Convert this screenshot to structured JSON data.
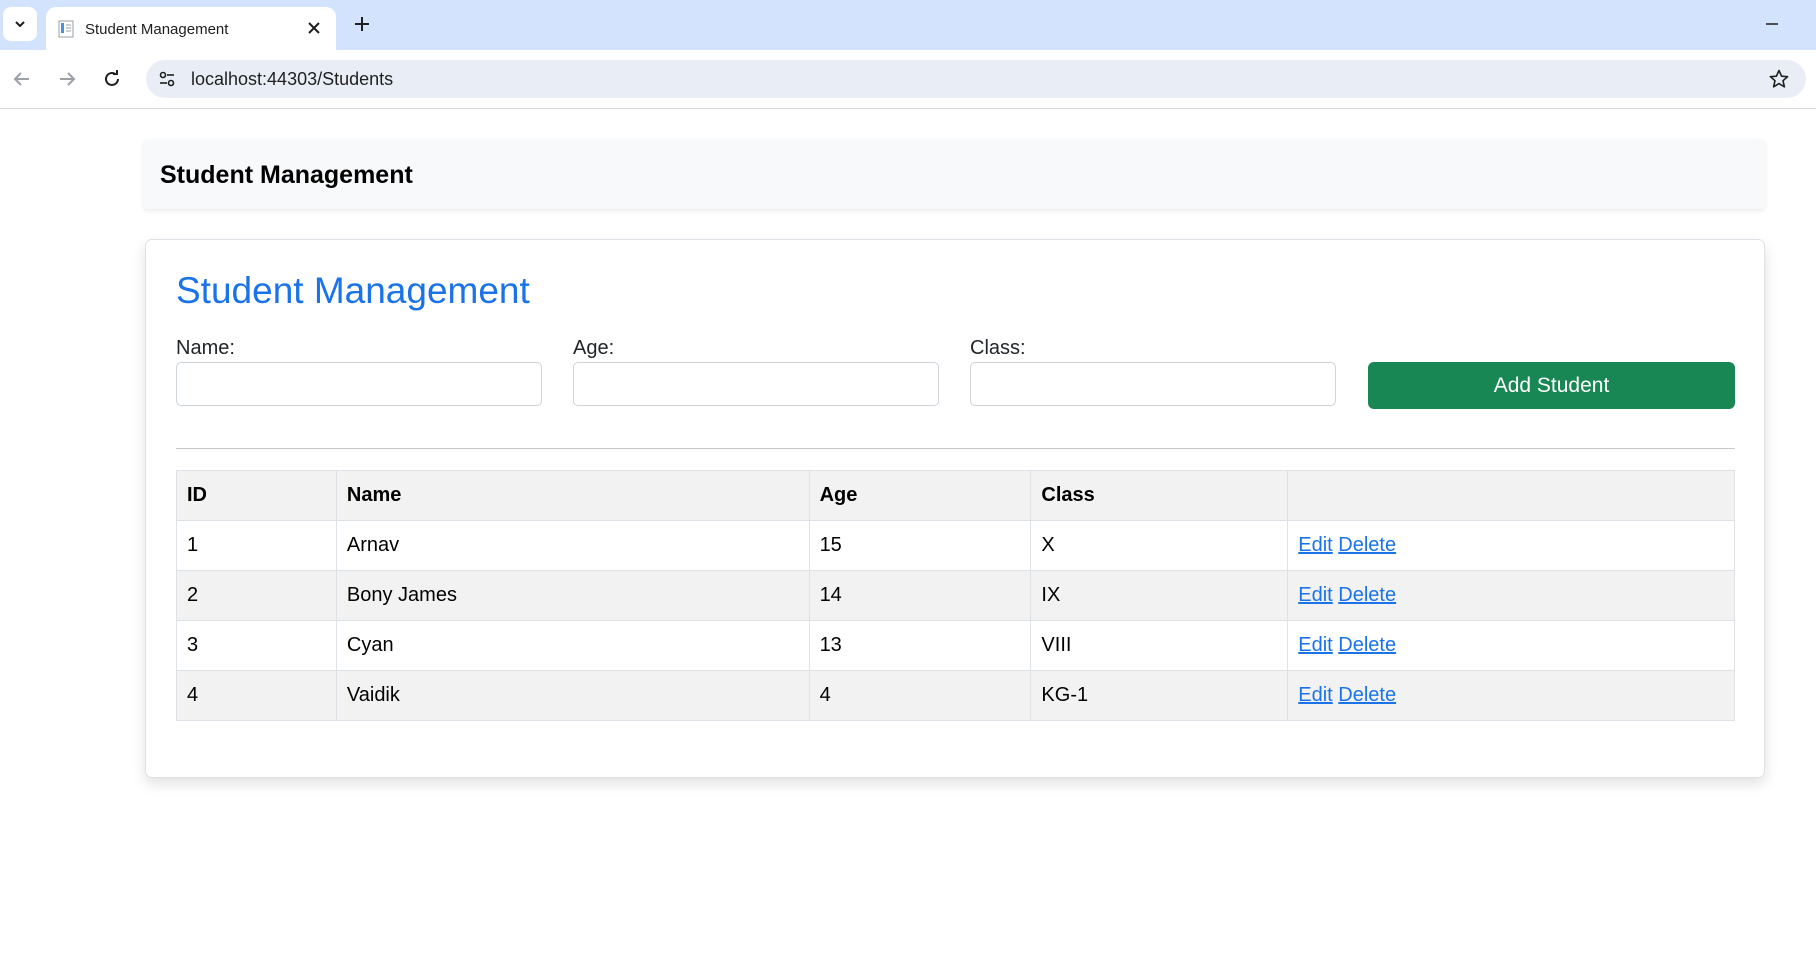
{
  "browser": {
    "tab_title": "Student Management",
    "url": "localhost:44303/Students"
  },
  "navbar": {
    "brand": "Student Management"
  },
  "card": {
    "title": "Student Management",
    "form": {
      "name_label": "Name:",
      "age_label": "Age:",
      "class_label": "Class:",
      "name_value": "",
      "age_value": "",
      "class_value": "",
      "add_button": "Add Student"
    },
    "table": {
      "headers": [
        "ID",
        "Name",
        "Age",
        "Class",
        ""
      ],
      "rows": [
        {
          "id": "1",
          "name": "Arnav",
          "age": "15",
          "class": "X"
        },
        {
          "id": "2",
          "name": "Bony James",
          "age": "14",
          "class": "IX"
        },
        {
          "id": "3",
          "name": "Cyan",
          "age": "13",
          "class": "VIII"
        },
        {
          "id": "4",
          "name": "Vaidik",
          "age": "4",
          "class": "KG-1"
        }
      ],
      "edit_label": "Edit",
      "delete_label": "Delete"
    }
  },
  "colors": {
    "title_blue": "#1a73e8",
    "add_button_green": "#198754",
    "tabstrip": "#d3e3fd"
  }
}
